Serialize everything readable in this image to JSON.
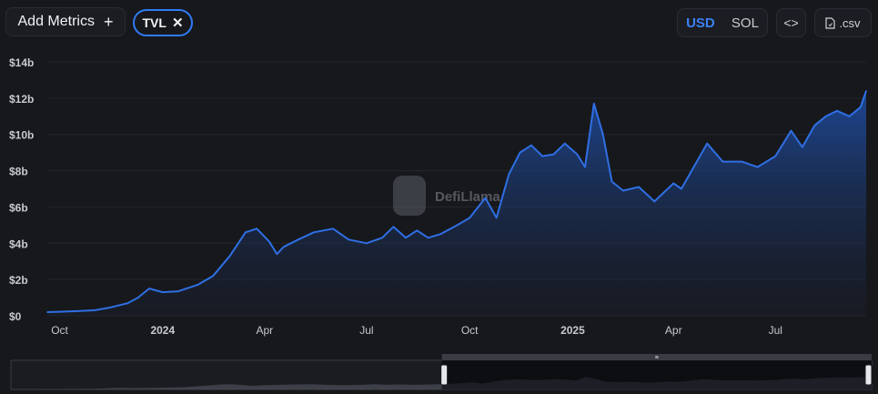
{
  "toolbar": {
    "add_metrics_label": "Add Metrics",
    "add_icon": "plus-icon",
    "metric_pill_label": "TVL",
    "remove_icon": "close-icon",
    "currency_options": [
      "USD",
      "SOL"
    ],
    "currency_selected": "USD",
    "embed_icon": "code-icon",
    "csv_label": ".csv",
    "csv_icon": "file-icon"
  },
  "watermark": {
    "text": "DefiLlama",
    "icon": "llama-logo-icon"
  },
  "colors": {
    "background": "#17181c",
    "line": "#2f6fe4",
    "accent": "#3b82f6",
    "tick_text": "#c7c9cf"
  },
  "chart_data": {
    "type": "area",
    "title": "",
    "xlabel": "",
    "ylabel": "",
    "ylim": [
      0,
      14
    ],
    "y_unit": "b",
    "y_ticks": [
      "$0",
      "$2b",
      "$4b",
      "$6b",
      "$8b",
      "$10b",
      "$12b",
      "$14b"
    ],
    "x_ticks": [
      "Oct",
      "2024",
      "Apr",
      "Jul",
      "Oct",
      "2025",
      "Apr",
      "Jul"
    ],
    "grid": true,
    "series": [
      {
        "x": [
          "2023-09-20",
          "2023-10-01",
          "2023-10-15",
          "2023-11-01",
          "2023-11-15",
          "2023-12-01",
          "2023-12-10",
          "2023-12-20",
          "2024-01-01",
          "2024-01-15",
          "2024-02-01",
          "2024-02-15",
          "2024-03-01",
          "2024-03-15",
          "2024-03-25",
          "2024-04-05",
          "2024-04-12",
          "2024-04-18",
          "2024-05-01",
          "2024-05-15",
          "2024-06-01",
          "2024-06-15",
          "2024-07-01",
          "2024-07-15",
          "2024-07-25",
          "2024-08-05",
          "2024-08-15",
          "2024-08-25",
          "2024-09-05",
          "2024-09-20",
          "2024-10-01",
          "2024-10-15",
          "2024-10-25",
          "2024-11-05",
          "2024-11-15",
          "2024-11-25",
          "2024-12-05",
          "2024-12-15",
          "2024-12-25",
          "2025-01-05",
          "2025-01-12",
          "2025-01-20",
          "2025-01-28",
          "2025-02-05",
          "2025-02-15",
          "2025-03-01",
          "2025-03-15",
          "2025-04-01",
          "2025-04-08",
          "2025-04-20",
          "2025-05-01",
          "2025-05-15",
          "2025-06-01",
          "2025-06-15",
          "2025-07-01",
          "2025-07-15",
          "2025-07-25",
          "2025-08-05",
          "2025-08-15",
          "2025-08-25",
          "2025-09-05",
          "2025-09-15",
          "2025-09-20"
        ],
        "values": [
          0.2,
          0.22,
          0.25,
          0.3,
          0.45,
          0.7,
          1.0,
          1.5,
          1.3,
          1.35,
          1.7,
          2.2,
          3.3,
          4.6,
          4.8,
          4.1,
          3.4,
          3.8,
          4.2,
          4.6,
          4.8,
          4.2,
          4.0,
          4.3,
          4.9,
          4.3,
          4.7,
          4.3,
          4.5,
          5.0,
          5.4,
          6.5,
          5.4,
          7.8,
          9.0,
          9.4,
          8.8,
          8.9,
          9.5,
          8.9,
          8.2,
          11.7,
          10.0,
          7.4,
          6.9,
          7.1,
          6.3,
          7.3,
          7.0,
          8.3,
          9.5,
          8.5,
          8.5,
          8.2,
          8.8,
          10.2,
          9.3,
          10.5,
          11.0,
          11.3,
          11.0,
          11.5,
          12.4
        ]
      }
    ],
    "brush": {
      "start": "2024-09-20",
      "end": "2025-09-20",
      "handle_label": "≡"
    }
  }
}
